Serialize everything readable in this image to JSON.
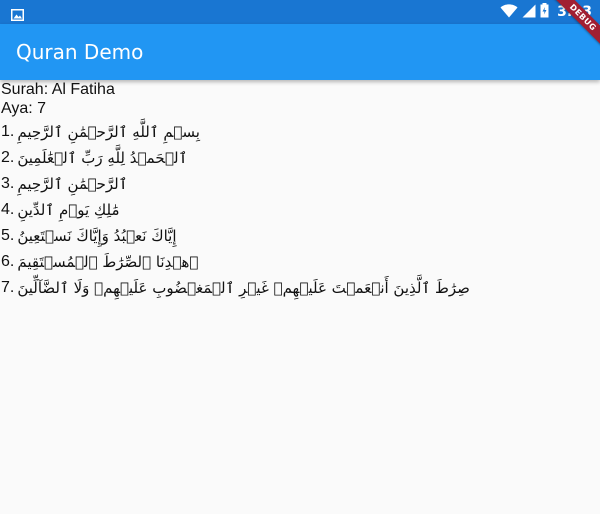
{
  "status_bar": {
    "time": "3:13",
    "icons": [
      "image-icon",
      "wifi-icon",
      "signal-icon",
      "battery-icon"
    ]
  },
  "app_bar": {
    "title": "Quran Demo",
    "color": "#2196f3"
  },
  "debug_banner": "DEBUG",
  "surah": {
    "label": "Surah: Al Fatiha",
    "aya_label": "Aya: 7"
  },
  "verses": [
    {
      "num": "1.",
      "text": "بِسۡمِ ٱللَّهِ ٱلرَّحۡمَٰنِ ٱلرَّحِيمِ"
    },
    {
      "num": "2.",
      "text": "ٱلۡحَمۡدُ لِلَّهِ رَبِّ ٱلۡعَٰلَمِينَ"
    },
    {
      "num": "3.",
      "text": "ٱلرَّحۡمَٰنِ ٱلرَّحِيمِ"
    },
    {
      "num": "4.",
      "text": "مَٰلِكِ يَوۡمِ ٱلدِّينِ"
    },
    {
      "num": "5.",
      "text": "إِيَّاكَ نَعۡبُدُ وَإِيَّاكَ نَسۡتَعِينُ"
    },
    {
      "num": "6.",
      "text": "ٱهۡدِنَا ٱلصِّرَٰطَ ٱلۡمُسۡتَقِيمَ"
    },
    {
      "num": "7.",
      "text": "صِرَٰطَ ٱلَّذِينَ أَنۡعَمۡتَ عَلَيۡهِمۡ غَيۡرِ ٱلۡمَغۡضُوبِ عَلَيۡهِمۡ وَلَا ٱلضَّآلِّينَ"
    }
  ]
}
